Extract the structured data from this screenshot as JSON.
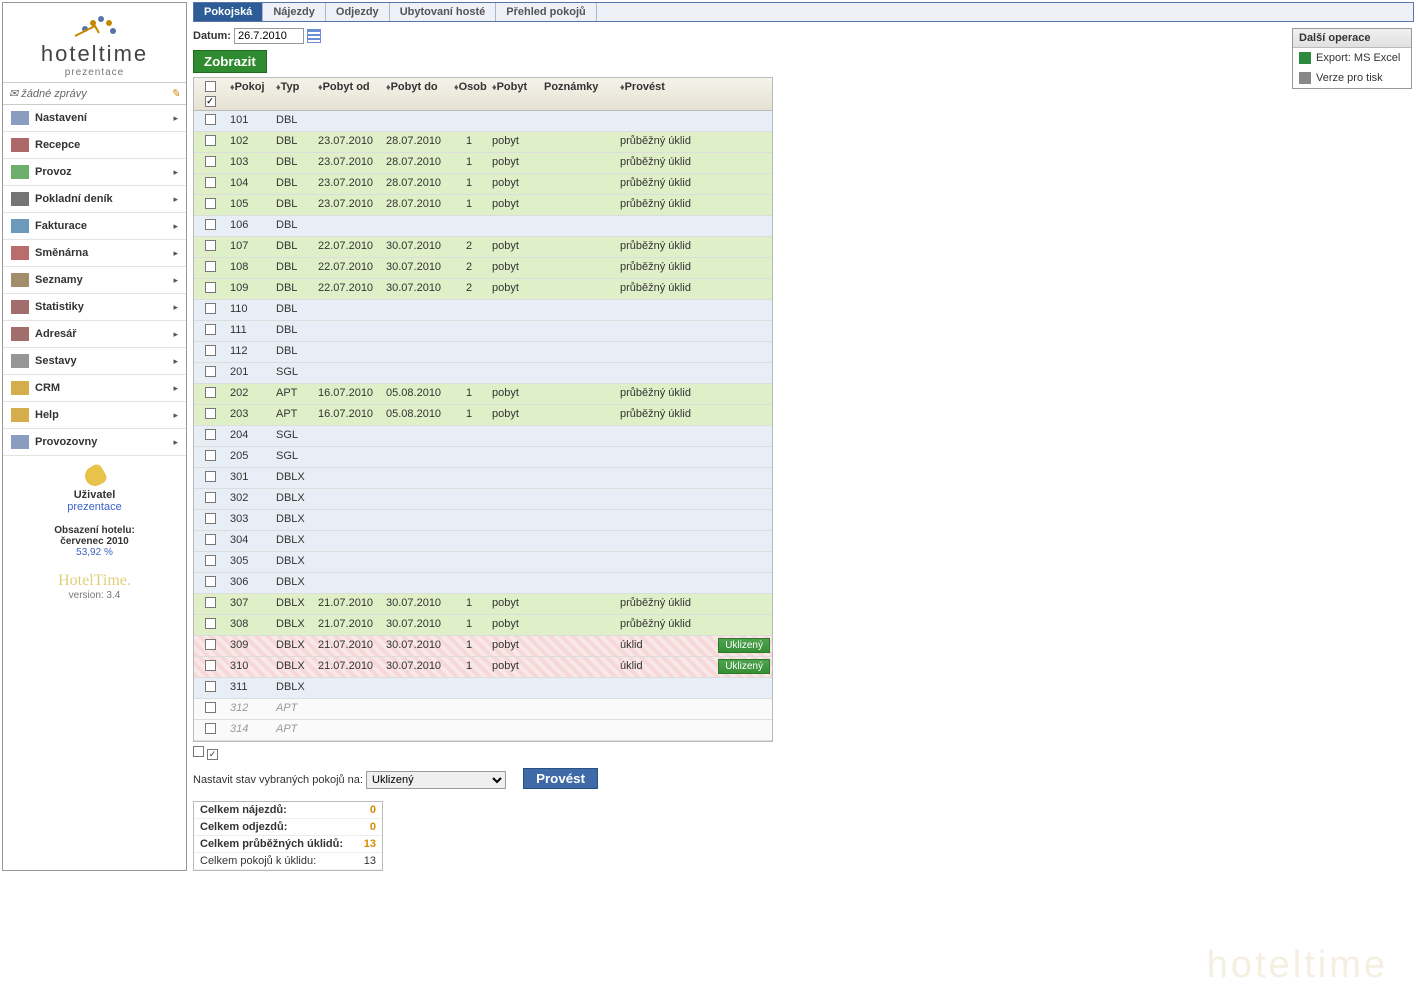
{
  "brand": {
    "name": "hoteltime",
    "sub": "prezentace",
    "version_label": "version: 3.4"
  },
  "messages": {
    "none": "žádné zprávy"
  },
  "nav": [
    {
      "label": "Nastavení",
      "arrow": true
    },
    {
      "label": "Recepce",
      "arrow": false
    },
    {
      "label": "Provoz",
      "arrow": true
    },
    {
      "label": "Pokladní deník",
      "arrow": true
    },
    {
      "label": "Fakturace",
      "arrow": true
    },
    {
      "label": "Směnárna",
      "arrow": true
    },
    {
      "label": "Seznamy",
      "arrow": true
    },
    {
      "label": "Statistiky",
      "arrow": true
    },
    {
      "label": "Adresář",
      "arrow": true
    },
    {
      "label": "Sestavy",
      "arrow": true
    },
    {
      "label": "CRM",
      "arrow": true
    },
    {
      "label": "Help",
      "arrow": true
    },
    {
      "label": "Provozovny",
      "arrow": true
    }
  ],
  "nav_colors": [
    "#5874a6",
    "#8a2a2a",
    "#2f8b2f",
    "#3a3a3a",
    "#2f6f9c",
    "#9c2f2f",
    "#7a5c2f",
    "#7a2f2f",
    "#7a2f2f",
    "#6a6a6a",
    "#c58a00",
    "#c58a00",
    "#5874a6"
  ],
  "user": {
    "label": "Uživatel",
    "name": "prezentace"
  },
  "occupancy": {
    "title": "Obsazení hotelu:",
    "month": "červenec 2010",
    "pct": "53,92 %"
  },
  "tabs": [
    "Pokojská",
    "Nájezdy",
    "Odjezdy",
    "Ubytovaní hosté",
    "Přehled pokojů"
  ],
  "date_label": "Datum:",
  "date_value": "26.7.2010",
  "btn_show": "Zobrazit",
  "headers": {
    "pokoj": "Pokoj",
    "typ": "Typ",
    "pobyt_od": "Pobyt od",
    "pobyt_do": "Pobyt do",
    "osob": "Osob",
    "pobyt": "Pobyt",
    "poznamky": "Poznámky",
    "provest": "Provést"
  },
  "rows": [
    {
      "pokoj": "101",
      "typ": "DBL",
      "style": "blue"
    },
    {
      "pokoj": "102",
      "typ": "DBL",
      "od": "23.07.2010",
      "do": "28.07.2010",
      "osob": "1",
      "pobyt": "pobyt",
      "prov": "průběžný úklid",
      "style": "green"
    },
    {
      "pokoj": "103",
      "typ": "DBL",
      "od": "23.07.2010",
      "do": "28.07.2010",
      "osob": "1",
      "pobyt": "pobyt",
      "prov": "průběžný úklid",
      "style": "green"
    },
    {
      "pokoj": "104",
      "typ": "DBL",
      "od": "23.07.2010",
      "do": "28.07.2010",
      "osob": "1",
      "pobyt": "pobyt",
      "prov": "průběžný úklid",
      "style": "green"
    },
    {
      "pokoj": "105",
      "typ": "DBL",
      "od": "23.07.2010",
      "do": "28.07.2010",
      "osob": "1",
      "pobyt": "pobyt",
      "prov": "průběžný úklid",
      "style": "green"
    },
    {
      "pokoj": "106",
      "typ": "DBL",
      "style": "blue"
    },
    {
      "pokoj": "107",
      "typ": "DBL",
      "od": "22.07.2010",
      "do": "30.07.2010",
      "osob": "2",
      "pobyt": "pobyt",
      "prov": "průběžný úklid",
      "style": "green"
    },
    {
      "pokoj": "108",
      "typ": "DBL",
      "od": "22.07.2010",
      "do": "30.07.2010",
      "osob": "2",
      "pobyt": "pobyt",
      "prov": "průběžný úklid",
      "style": "green"
    },
    {
      "pokoj": "109",
      "typ": "DBL",
      "od": "22.07.2010",
      "do": "30.07.2010",
      "osob": "2",
      "pobyt": "pobyt",
      "prov": "průběžný úklid",
      "style": "green"
    },
    {
      "pokoj": "110",
      "typ": "DBL",
      "style": "blue"
    },
    {
      "pokoj": "111",
      "typ": "DBL",
      "style": "blue"
    },
    {
      "pokoj": "112",
      "typ": "DBL",
      "style": "blue"
    },
    {
      "pokoj": "201",
      "typ": "SGL",
      "style": "blue"
    },
    {
      "pokoj": "202",
      "typ": "APT",
      "od": "16.07.2010",
      "do": "05.08.2010",
      "osob": "1",
      "pobyt": "pobyt",
      "prov": "průběžný úklid",
      "style": "green"
    },
    {
      "pokoj": "203",
      "typ": "APT",
      "od": "16.07.2010",
      "do": "05.08.2010",
      "osob": "1",
      "pobyt": "pobyt",
      "prov": "průběžný úklid",
      "style": "green"
    },
    {
      "pokoj": "204",
      "typ": "SGL",
      "style": "blue"
    },
    {
      "pokoj": "205",
      "typ": "SGL",
      "style": "blue"
    },
    {
      "pokoj": "301",
      "typ": "DBLX",
      "style": "blue"
    },
    {
      "pokoj": "302",
      "typ": "DBLX",
      "style": "blue"
    },
    {
      "pokoj": "303",
      "typ": "DBLX",
      "style": "blue"
    },
    {
      "pokoj": "304",
      "typ": "DBLX",
      "style": "blue"
    },
    {
      "pokoj": "305",
      "typ": "DBLX",
      "style": "blue"
    },
    {
      "pokoj": "306",
      "typ": "DBLX",
      "style": "blue"
    },
    {
      "pokoj": "307",
      "typ": "DBLX",
      "od": "21.07.2010",
      "do": "30.07.2010",
      "osob": "1",
      "pobyt": "pobyt",
      "prov": "průběžný úklid",
      "style": "green"
    },
    {
      "pokoj": "308",
      "typ": "DBLX",
      "od": "21.07.2010",
      "do": "30.07.2010",
      "osob": "1",
      "pobyt": "pobyt",
      "prov": "průběžný úklid",
      "style": "green"
    },
    {
      "pokoj": "309",
      "typ": "DBLX",
      "od": "21.07.2010",
      "do": "30.07.2010",
      "osob": "1",
      "pobyt": "pobyt",
      "prov": "úklid",
      "style": "red",
      "btn": "Uklizený"
    },
    {
      "pokoj": "310",
      "typ": "DBLX",
      "od": "21.07.2010",
      "do": "30.07.2010",
      "osob": "1",
      "pobyt": "pobyt",
      "prov": "úklid",
      "style": "red",
      "btn": "Uklizený"
    },
    {
      "pokoj": "311",
      "typ": "DBLX",
      "style": "blue"
    },
    {
      "pokoj": "312",
      "typ": "APT",
      "style": "dim"
    },
    {
      "pokoj": "314",
      "typ": "APT",
      "style": "dim"
    }
  ],
  "status_label": "Nastavit stav vybraných pokojů na:",
  "status_value": "Uklizený",
  "btn_provest": "Provést",
  "summary": [
    {
      "label": "Celkem nájezdů:",
      "value": "0",
      "bold": true
    },
    {
      "label": "Celkem odjezdů:",
      "value": "0",
      "bold": true
    },
    {
      "label": "Celkem průběžných úklidů:",
      "value": "13",
      "bold": true
    },
    {
      "label": "Celkem pokojů k úklidu:",
      "value": "13",
      "bold": false
    }
  ],
  "ops": {
    "title": "Další operace",
    "excel": "Export: MS Excel",
    "print": "Verze pro tisk"
  },
  "watermark": "hoteltime"
}
